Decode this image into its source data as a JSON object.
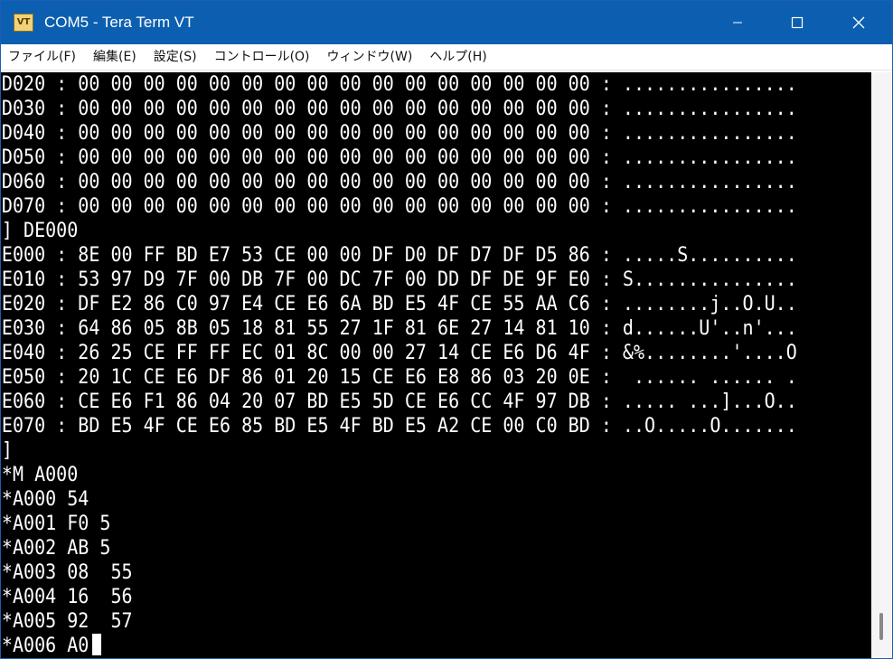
{
  "window": {
    "title": "COM5 - Tera Term VT",
    "icon_text": "VT"
  },
  "menu": [
    {
      "label": "ファイル(F)"
    },
    {
      "label": "編集(E)"
    },
    {
      "label": "設定(S)"
    },
    {
      "label": "コントロール(O)"
    },
    {
      "label": "ウィンドウ(W)"
    },
    {
      "label": "ヘルプ(H)"
    }
  ],
  "terminal": {
    "lines": [
      "D020 : 00 00 00 00 00 00 00 00 00 00 00 00 00 00 00 00 : ................",
      "D030 : 00 00 00 00 00 00 00 00 00 00 00 00 00 00 00 00 : ................",
      "D040 : 00 00 00 00 00 00 00 00 00 00 00 00 00 00 00 00 : ................",
      "D050 : 00 00 00 00 00 00 00 00 00 00 00 00 00 00 00 00 : ................",
      "D060 : 00 00 00 00 00 00 00 00 00 00 00 00 00 00 00 00 : ................",
      "D070 : 00 00 00 00 00 00 00 00 00 00 00 00 00 00 00 00 : ................",
      "] DE000",
      "E000 : 8E 00 FF BD E7 53 CE 00 00 DF D0 DF D7 DF D5 86 : .....S..........",
      "E010 : 53 97 D9 7F 00 DB 7F 00 DC 7F 00 DD DF DE 9F E0 : S...............",
      "E020 : DF E2 86 C0 97 E4 CE E6 6A BD E5 4F CE 55 AA C6 : ........j..O.U..",
      "E030 : 64 86 05 8B 05 18 81 55 27 1F 81 6E 27 14 81 10 : d......U'..n'...",
      "E040 : 26 25 CE FF FF EC 01 8C 00 00 27 14 CE E6 D6 4F : &%........'....O",
      "E050 : 20 1C CE E6 DF 86 01 20 15 CE E6 E8 86 03 20 0E :  ...... ...... .",
      "E060 : CE E6 F1 86 04 20 07 BD E5 5D CE E6 CC 4F 97 DB : ..... ...]...O..",
      "E070 : BD E5 4F CE E6 85 BD E5 4F BD E5 A2 CE 00 C0 BD : ..O.....O.......",
      "]",
      "*M A000",
      "*A000 54",
      "*A001 F0 5",
      "*A002 AB 5",
      "*A003 08  55",
      "*A004 16  56",
      "*A005 92  57",
      "*A006 A0"
    ]
  },
  "colors": {
    "titlebar": "#0c5fb0",
    "terminal_bg": "#000000",
    "terminal_fg": "#ffffff"
  },
  "icons": {
    "minimize": "minimize-icon",
    "maximize": "maximize-icon",
    "close": "close-icon"
  }
}
